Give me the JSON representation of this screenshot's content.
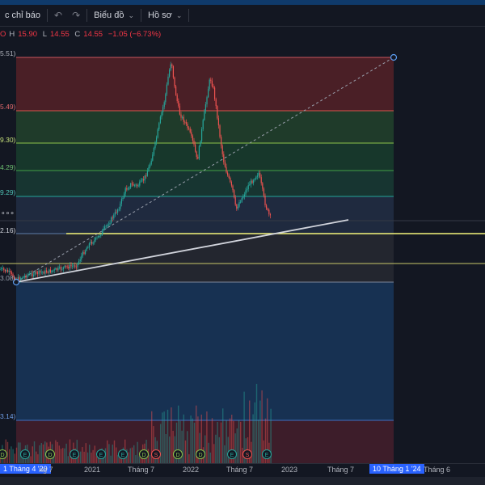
{
  "toolbar": {
    "indicators_label": "c chỉ báo",
    "undo_icon": "undo-icon",
    "redo_icon": "redo-icon",
    "chart_label": "Biểu đồ",
    "profile_label": "Hồ sơ"
  },
  "legend": {
    "high_label": "H",
    "high_value": "15.90",
    "low_label": "L",
    "low_value": "14.55",
    "close_label": "C",
    "close_value": "14.55",
    "change": "−1.05 (−6.73%)"
  },
  "fib_labels": [
    "5.51)",
    "5.49)",
    "9.30)",
    "4.29)",
    "9.29)",
    "2.16)",
    "3.08)",
    "3.14)"
  ],
  "menu_dots": "∘∘∘",
  "x_axis": {
    "labels": [
      "1 Tháng 4 '20",
      "ng 7",
      "2021",
      "Tháng 7",
      "2022",
      "Tháng 7",
      "2023",
      "Tháng 7",
      "10 Tháng 1 '24",
      "Tháng 6"
    ]
  },
  "events": {
    "labels": [
      "D",
      "E",
      "D",
      "E",
      "E",
      "E",
      "D",
      "S",
      "D",
      "D",
      "E",
      "S",
      "E"
    ]
  },
  "colors": {
    "background": "#131722",
    "up": "#26a69a",
    "down": "#ef5350",
    "trendline": "#d1d4dc",
    "horizontal": "#f5f57a",
    "accent": "#2962ff"
  }
}
